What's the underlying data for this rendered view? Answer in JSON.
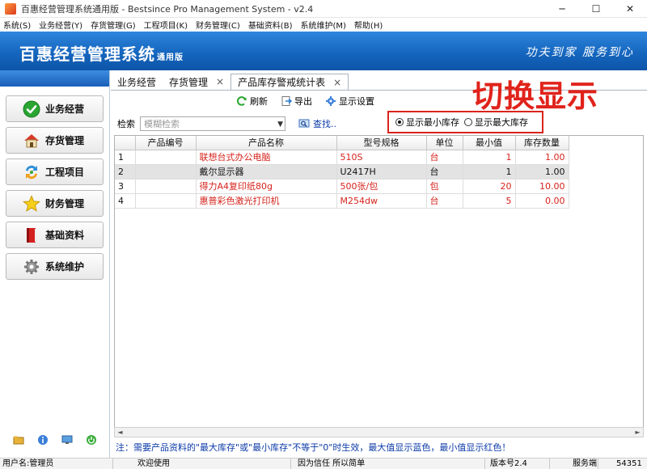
{
  "window": {
    "title": "百惠经营管理系统通用版 - Bestsince Pro Management System - v2.4",
    "minimize": "─",
    "maximize": "☐",
    "close": "✕"
  },
  "menu": [
    "系统(S)",
    "业务经营(Y)",
    "存货管理(G)",
    "工程项目(K)",
    "财务管理(C)",
    "基础资料(B)",
    "系统维护(M)",
    "帮助(H)"
  ],
  "banner": {
    "brand": "百惠经营管理系统",
    "edition": "通用版",
    "slogan": "功夫到家 服务到心"
  },
  "sidebar": {
    "items": [
      {
        "label": "业务经营",
        "icon": "check-icon"
      },
      {
        "label": "存货管理",
        "icon": "house-icon"
      },
      {
        "label": "工程项目",
        "icon": "recycle-icon"
      },
      {
        "label": "财务管理",
        "icon": "star-icon"
      },
      {
        "label": "基础资料",
        "icon": "book-icon"
      },
      {
        "label": "系统维护",
        "icon": "gear-icon"
      }
    ]
  },
  "tabs": [
    {
      "label": "业务经营"
    },
    {
      "label": "存货管理"
    },
    {
      "label": "产品库存警戒统计表",
      "active": true
    }
  ],
  "toolbar": {
    "refresh": "刷新",
    "export": "导出",
    "display_settings": "显示设置"
  },
  "search": {
    "label": "检索",
    "placeholder": "模糊检索",
    "find": "查找.."
  },
  "radios": {
    "min": "显示最小库存",
    "max": "显示最大库存",
    "selected": "min"
  },
  "annotation": "切换显示",
  "table": {
    "columns": [
      "",
      "产品编号",
      "产品名称",
      "型号规格",
      "单位",
      "最小值",
      "库存数量"
    ],
    "rows": [
      {
        "idx": "1",
        "code": "",
        "name": "联想台式办公电脑",
        "model": "510S",
        "unit": "台",
        "min": "1",
        "qty": "1.00",
        "color": "red"
      },
      {
        "idx": "2",
        "code": "",
        "name": "戴尔显示器",
        "model": "U2417H",
        "unit": "台",
        "min": "1",
        "qty": "1.00",
        "color": "black"
      },
      {
        "idx": "3",
        "code": "",
        "name": "得力A4复印纸80g",
        "model": "500张/包",
        "unit": "包",
        "min": "20",
        "qty": "10.00",
        "color": "red"
      },
      {
        "idx": "4",
        "code": "",
        "name": "惠普彩色激光打印机",
        "model": "M254dw",
        "unit": "台",
        "min": "5",
        "qty": "0.00",
        "color": "red"
      }
    ]
  },
  "note": "注：需要产品资料的\"最大库存\"或\"最小库存\"不等于\"0\"时生效，最大值显示蓝色，最小值显示红色！",
  "status": {
    "user": "用户名:管理员",
    "welcome": "欢迎使用",
    "motto": "因为信任 所以简单",
    "version": "版本号2.4",
    "server_label": "服务端",
    "port": "54351"
  },
  "colors": {
    "banner": "#1566bf",
    "accent_red": "#d9241c",
    "row_red": "#d6231c",
    "note_blue": "#0b3aa8"
  }
}
